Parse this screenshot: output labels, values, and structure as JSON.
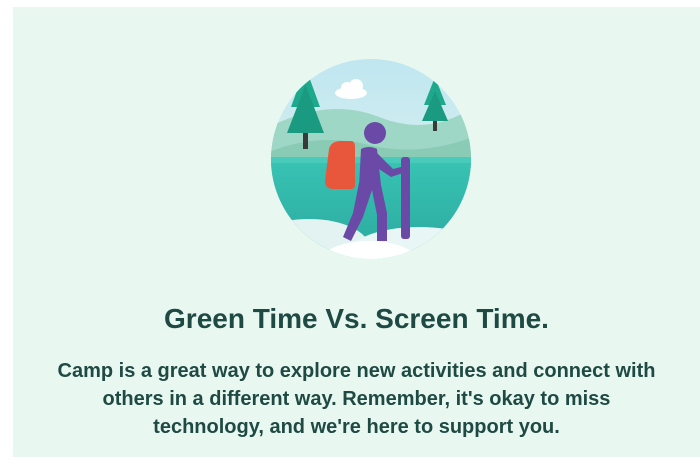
{
  "card": {
    "title": "Green Time Vs. Screen Time.",
    "body": "Camp is a great way to explore new activities and connect with others in a different way. Remember, it's okay to miss technology, and we're here to support you."
  },
  "colors": {
    "background": "#e8f8f1",
    "text": "#1f4a43",
    "hiker": "#6a4aa6",
    "backpack": "#e8573c",
    "tree": "#1ea88c",
    "water": "#2bbbb0"
  },
  "illustration": {
    "icon": "hiker-icon"
  }
}
